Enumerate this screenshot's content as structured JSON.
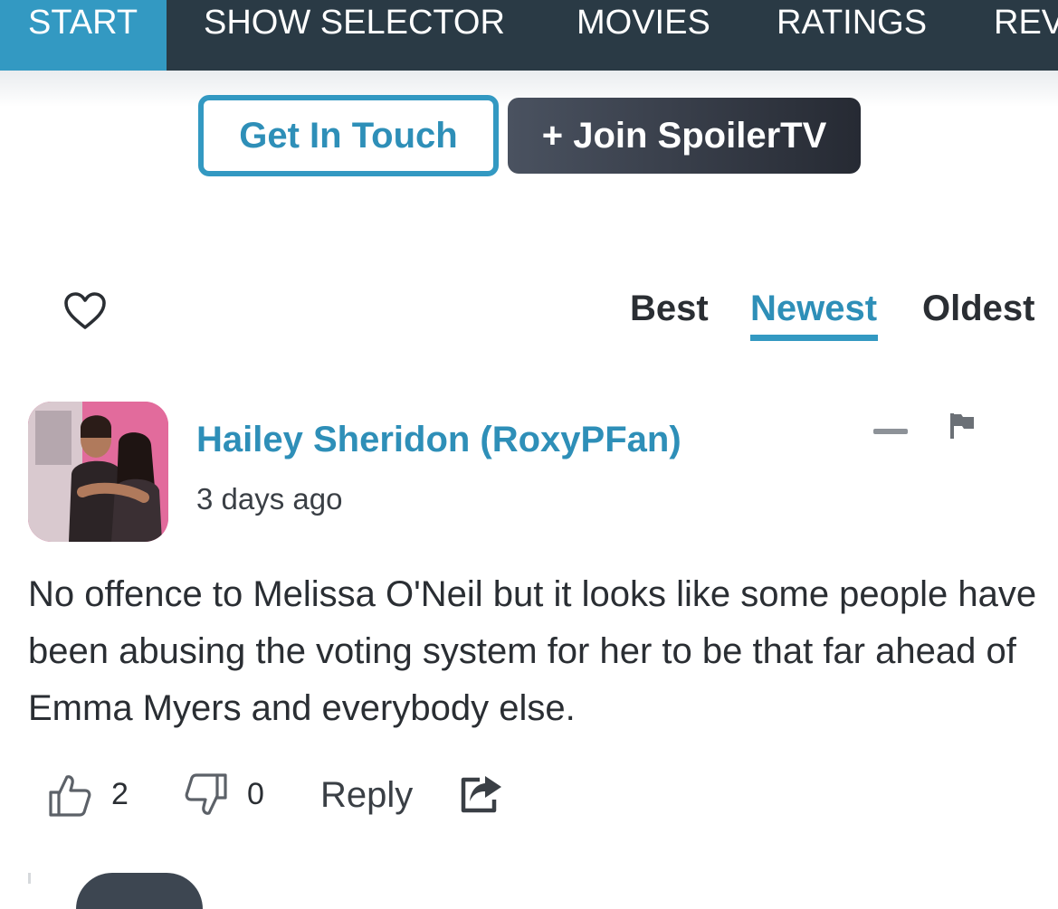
{
  "nav": {
    "items": [
      {
        "label": "START",
        "active": true
      },
      {
        "label": "SHOW SELECTOR",
        "active": false
      },
      {
        "label": "MOVIES",
        "active": false
      },
      {
        "label": "RATINGS",
        "active": false
      },
      {
        "label": "REV",
        "active": false
      }
    ]
  },
  "cta": {
    "get_in_touch": "Get In Touch",
    "join": "+ Join SpoilerTV"
  },
  "sort": {
    "heart_icon": "heart-icon",
    "tabs": [
      {
        "label": "Best",
        "active": false
      },
      {
        "label": "Newest",
        "active": true
      },
      {
        "label": "Oldest",
        "active": false
      }
    ]
  },
  "comment": {
    "author": "Hailey Sheridon (RoxyPFan)",
    "timestamp": "3 days ago",
    "body": "No offence to Melissa O'Neil but it looks like some people have been abusing the voting system for her to be that far ahead of Emma Myers and everybody else.",
    "upvotes": "2",
    "downvotes": "0",
    "reply_label": "Reply"
  },
  "colors": {
    "accent": "#3399c2",
    "nav_bg": "#2a3a45",
    "join_bg": "#343842"
  }
}
